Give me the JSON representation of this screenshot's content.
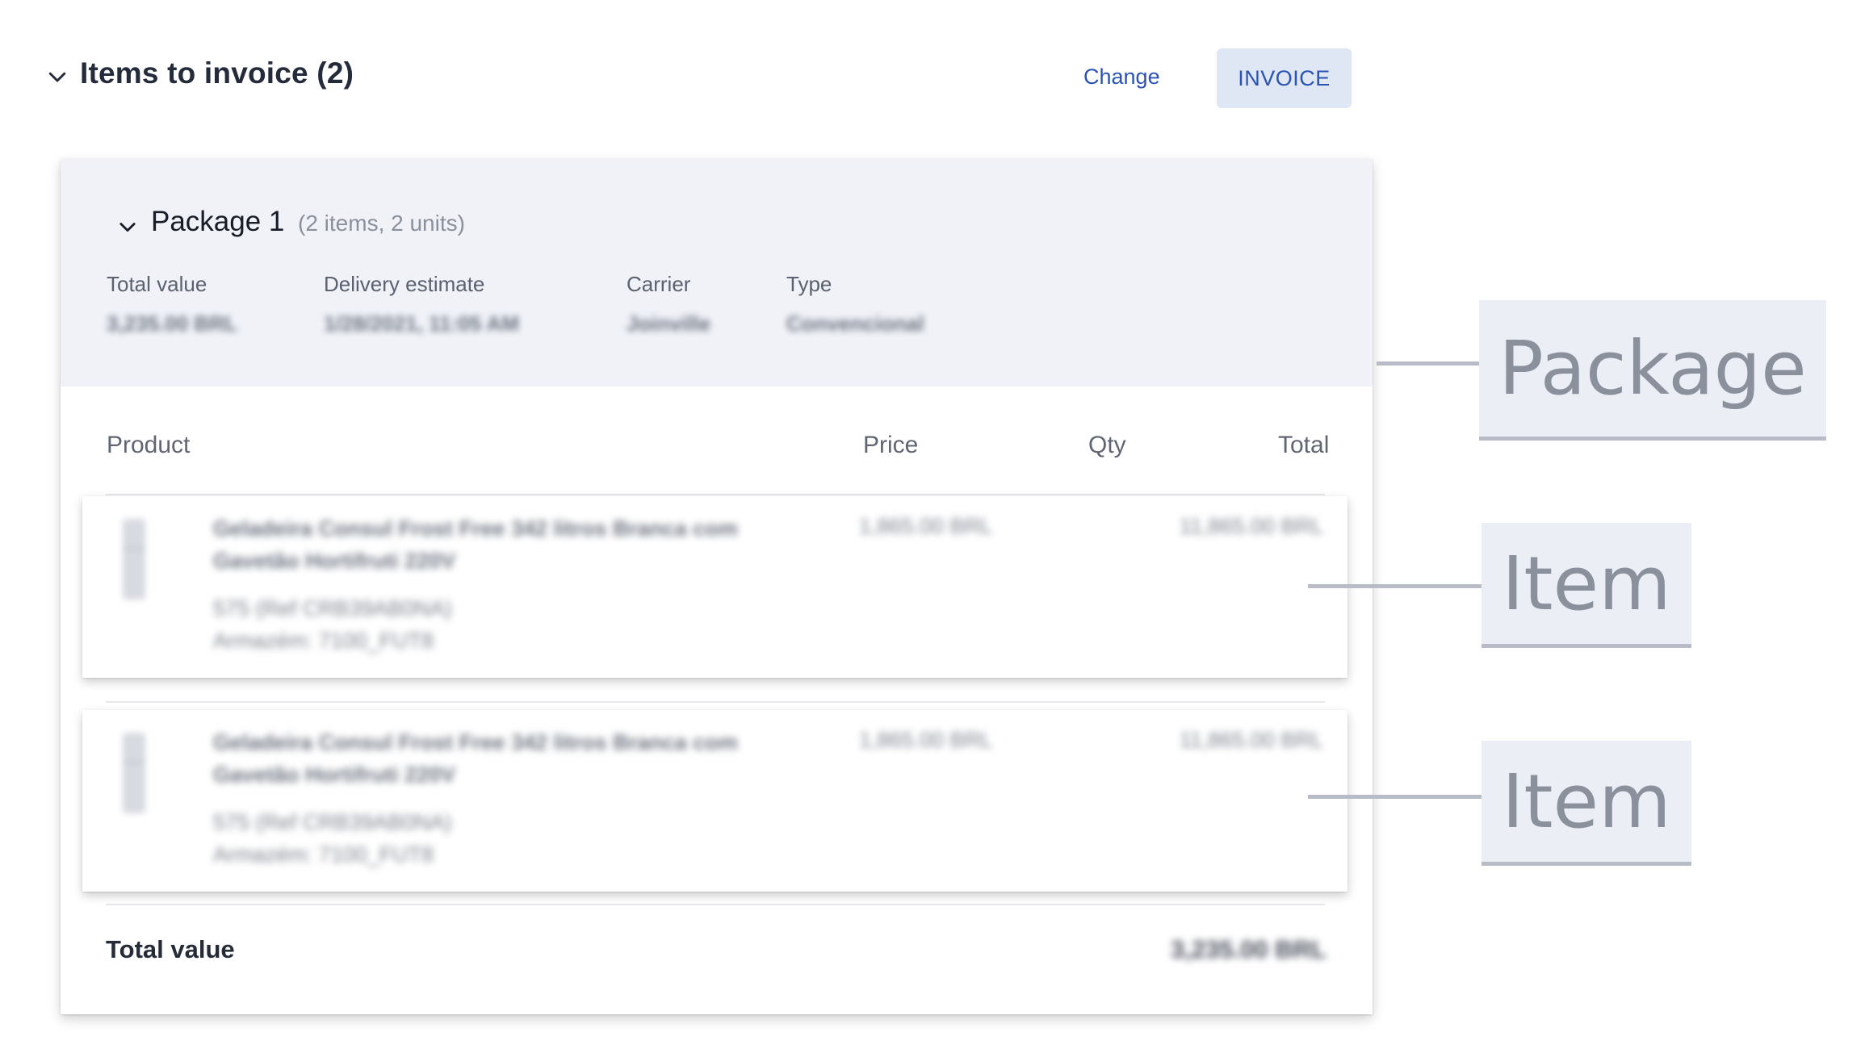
{
  "section": {
    "title": "Items to invoice (2)",
    "change_label": "Change",
    "invoice_label": "INVOICE",
    "accent_color": "#2a53b3"
  },
  "package": {
    "title": "Package 1",
    "subtitle": "(2 items, 2 units)",
    "meta": [
      {
        "label": "Total value",
        "value": "3,235.00 BRL"
      },
      {
        "label": "Delivery estimate",
        "value": "1/28/2021, 11:05 AM"
      },
      {
        "label": "Carrier",
        "value": "Joinville"
      },
      {
        "label": "Type",
        "value": "Convencional"
      }
    ],
    "columns": {
      "product": "Product",
      "price": "Price",
      "qty": "Qty",
      "total": "Total"
    },
    "items": [
      {
        "name": "Geladeira Consul Frost Free 342 litros Branca com Gavetão Hortifruti 220V",
        "sku": "575 (Ref CRB39AB0NA)",
        "warehouse": "Armazém: 7100_FUT8",
        "price": "1,865.00 BRL",
        "total": "11,865.00 BRL"
      },
      {
        "name": "Geladeira Consul Frost Free 342 litros Branca com Gavetão Hortifruti 220V",
        "sku": "575 (Ref CRB39AB0NA)",
        "warehouse": "Armazém: 7100_FUT8",
        "price": "1,865.00 BRL",
        "total": "11,865.00 BRL"
      }
    ],
    "total_label": "Total value",
    "total_value": "3,235.00 BRL"
  },
  "annotations": {
    "package": "Package",
    "item_1": "Item",
    "item_2": "Item"
  }
}
